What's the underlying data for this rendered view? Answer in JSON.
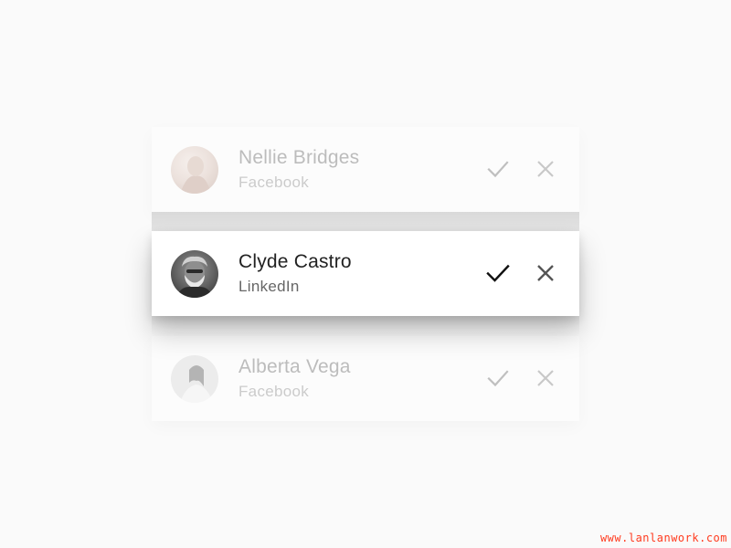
{
  "requests": [
    {
      "name": "Nellie Bridges",
      "source": "Facebook",
      "state": "dimmed",
      "avatar": "profile-photo"
    },
    {
      "name": "Clyde Castro",
      "source": "LinkedIn",
      "state": "focused",
      "avatar": "profile-photo"
    },
    {
      "name": "Alberta Vega",
      "source": "Facebook",
      "state": "dimmed",
      "avatar": "profile-photo"
    }
  ],
  "icons": {
    "accept": "check-icon",
    "reject": "close-icon"
  },
  "colors": {
    "background": "#fafafa",
    "card": "#ffffff",
    "text_primary": "#222222",
    "text_secondary": "#666666",
    "watermark": "#ff3b1f"
  },
  "watermark": "www.lanlanwork.com"
}
